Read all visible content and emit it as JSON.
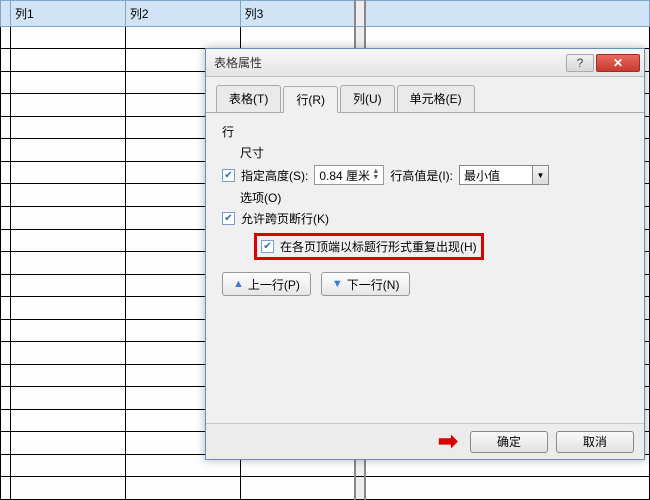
{
  "table": {
    "headers": [
      "列1",
      "列2",
      "列3"
    ]
  },
  "dialog": {
    "title": "表格属性",
    "tabs": {
      "table": "表格(T)",
      "row": "行(R)",
      "column": "列(U)",
      "cell": "单元格(E)"
    },
    "section_row": "行",
    "size_label": "尺寸",
    "specify_height": "指定高度(S):",
    "height_value": "0.84 厘米",
    "height_mode_label": "行高值是(I):",
    "height_mode_value": "最小值",
    "options_label": "选项(O)",
    "allow_break": "允许跨页断行(K)",
    "repeat_header": "在各页顶端以标题行形式重复出现(H)",
    "prev_row": "上一行(P)",
    "next_row": "下一行(N)",
    "ok": "确定",
    "cancel": "取消"
  }
}
